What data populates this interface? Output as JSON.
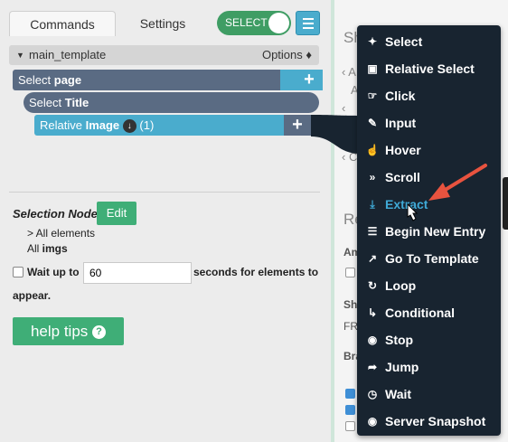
{
  "tabs": {
    "commands": "Commands",
    "settings": "Settings"
  },
  "select_toggle": {
    "label": "SELECT"
  },
  "template": {
    "name": "main_template",
    "options": "Options ♦"
  },
  "nodes": {
    "page": {
      "prefix": "Select ",
      "name": "page"
    },
    "title": {
      "prefix": "Select ",
      "name": "Title"
    },
    "image": {
      "prefix": "Relative ",
      "name": "Image",
      "count": "(1)"
    }
  },
  "selection": {
    "label": "Selection Node:",
    "edit": "Edit",
    "all_elements": "> All elements",
    "all_prefix": "All ",
    "all_name": "imgs"
  },
  "wait": {
    "label": "Wait up to",
    "value": "60",
    "suffix": "seconds for elements to",
    "suffix2": "appear."
  },
  "help": {
    "label": "help tips"
  },
  "right_panel": {
    "s_letter": "Sh",
    "lines": [
      "‹  A",
      "A",
      "‹",
      "C",
      "‹  C"
    ],
    "re": "Re",
    "am": "Am",
    "sh2": "Sh",
    "fr": "FR",
    "br": "Bra"
  },
  "menu": {
    "items": [
      {
        "icon": "select-icon",
        "label": "Select"
      },
      {
        "icon": "relative-select-icon",
        "label": "Relative Select"
      },
      {
        "icon": "click-icon",
        "label": "Click"
      },
      {
        "icon": "input-icon",
        "label": "Input"
      },
      {
        "icon": "hover-icon",
        "label": "Hover"
      },
      {
        "icon": "scroll-icon",
        "label": "Scroll"
      },
      {
        "icon": "extract-icon",
        "label": "Extract",
        "active": true
      },
      {
        "icon": "begin-new-entry-icon",
        "label": "Begin New Entry"
      },
      {
        "icon": "go-to-template-icon",
        "label": "Go To Template"
      },
      {
        "icon": "loop-icon",
        "label": "Loop"
      },
      {
        "icon": "conditional-icon",
        "label": "Conditional"
      },
      {
        "icon": "stop-icon",
        "label": "Stop"
      },
      {
        "icon": "jump-icon",
        "label": "Jump"
      },
      {
        "icon": "wait-icon",
        "label": "Wait"
      },
      {
        "icon": "server-snapshot-icon",
        "label": "Server Snapshot"
      }
    ]
  },
  "colors": {
    "accent": "#4aaccd",
    "green": "#3fae77",
    "slate": "#5a6b83",
    "menu_bg": "#182430",
    "active_item": "#3fa9d6",
    "arrow": "#e8533f"
  }
}
